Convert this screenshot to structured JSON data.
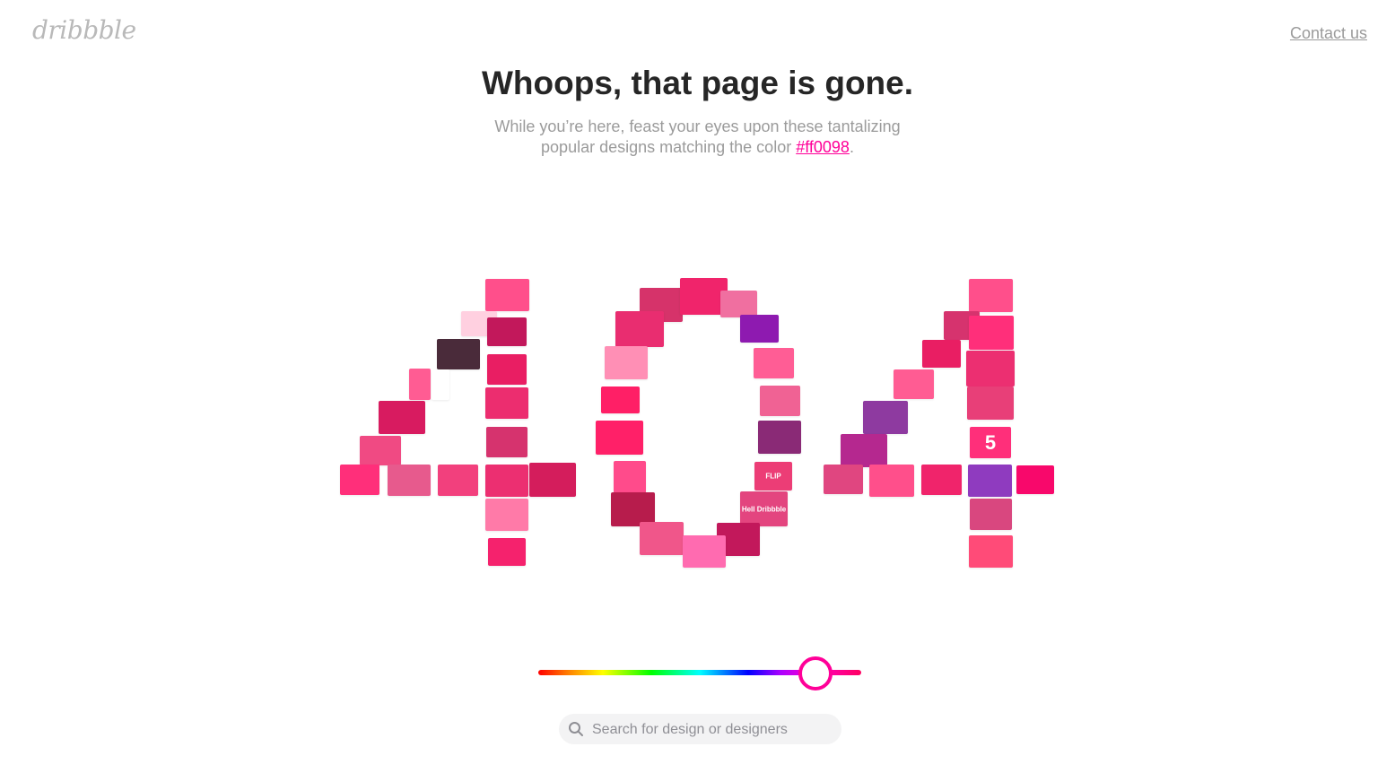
{
  "header": {
    "logo_text": "dribbble",
    "contact_label": "Contact us"
  },
  "main": {
    "title": "Whoops, that page is gone.",
    "subtitle_line1": "While you’re here, feast your eyes upon these tantalizing",
    "subtitle_line2_prefix": "popular designs matching the color ",
    "color_link": "#ff0098",
    "subtitle_line2_suffix": "."
  },
  "mosaic": {
    "digits": [
      "4",
      "0",
      "4"
    ],
    "shot_labels": [
      "FLIP",
      "Hell Dribbble",
      "5"
    ]
  },
  "color_slider": {
    "selected_color": "#ff0098"
  },
  "search": {
    "placeholder": "Search for design or designers",
    "value": ""
  },
  "colors": {
    "accent": "#ff0098",
    "title": "#262626",
    "subtitle": "#9b9b9b",
    "logo": "#b9b9b9"
  }
}
